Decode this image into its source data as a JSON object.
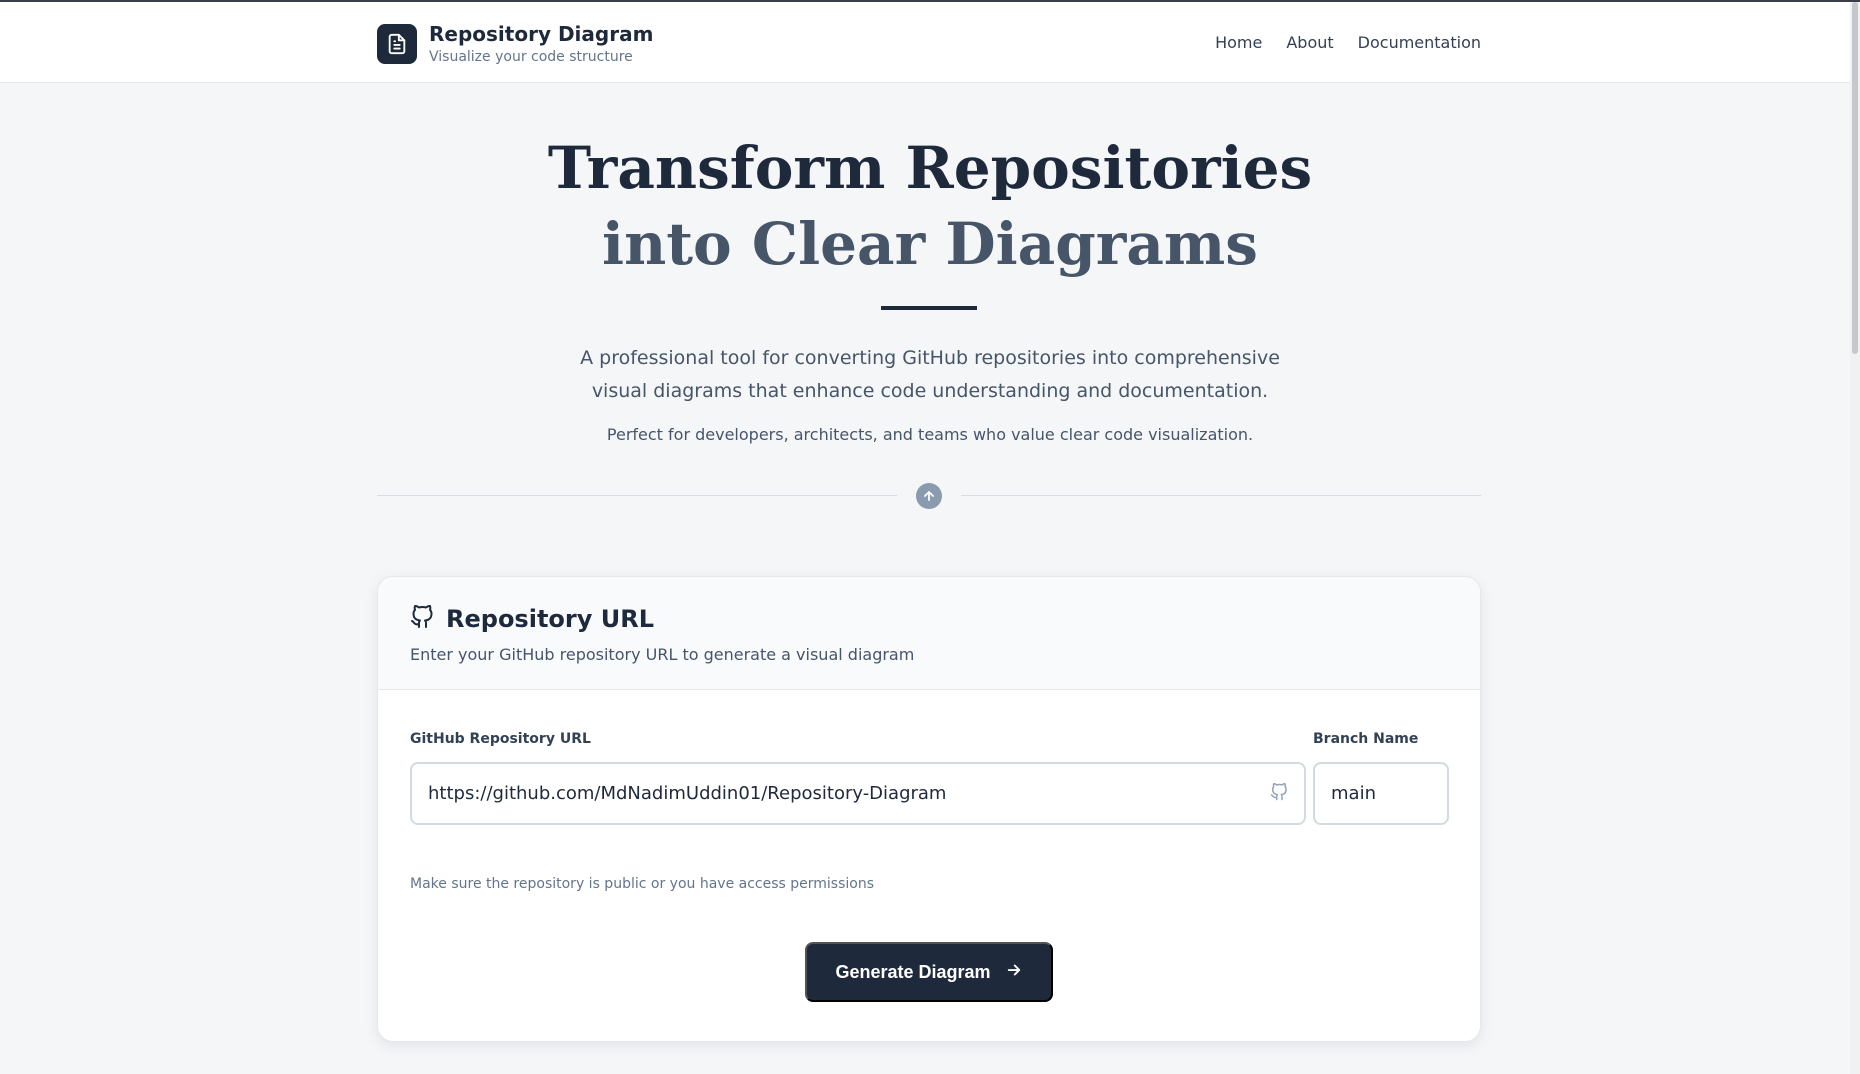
{
  "header": {
    "brand_title": "Repository Diagram",
    "brand_subtitle": "Visualize your code structure",
    "nav": [
      {
        "label": "Home"
      },
      {
        "label": "About"
      },
      {
        "label": "Documentation"
      }
    ]
  },
  "hero": {
    "title_line1": "Transform Repositories",
    "title_line2": "into Clear Diagrams",
    "description": "A professional tool for converting GitHub repositories into comprehensive visual diagrams that enhance code understanding and documentation.",
    "note": "Perfect for developers, architects, and teams who value clear code visualization."
  },
  "card": {
    "title": "Repository URL",
    "description": "Enter your GitHub repository URL to generate a visual diagram",
    "url_label": "GitHub Repository URL",
    "url_value": "https://github.com/MdNadimUddin01/Repository-Diagram",
    "branch_label": "Branch Name",
    "branch_value": "main",
    "hint": "Make sure the repository is public or you have access permissions",
    "button_label": "Generate Diagram"
  },
  "icons": {
    "logo": "document-icon",
    "divider": "arrow-up-circle-icon",
    "card_title": "github-icon",
    "input": "github-icon",
    "button": "arrow-right-icon"
  },
  "colors": {
    "primary": "#1e293b",
    "accent_text": "#475569",
    "background": "#f4f6f8"
  }
}
